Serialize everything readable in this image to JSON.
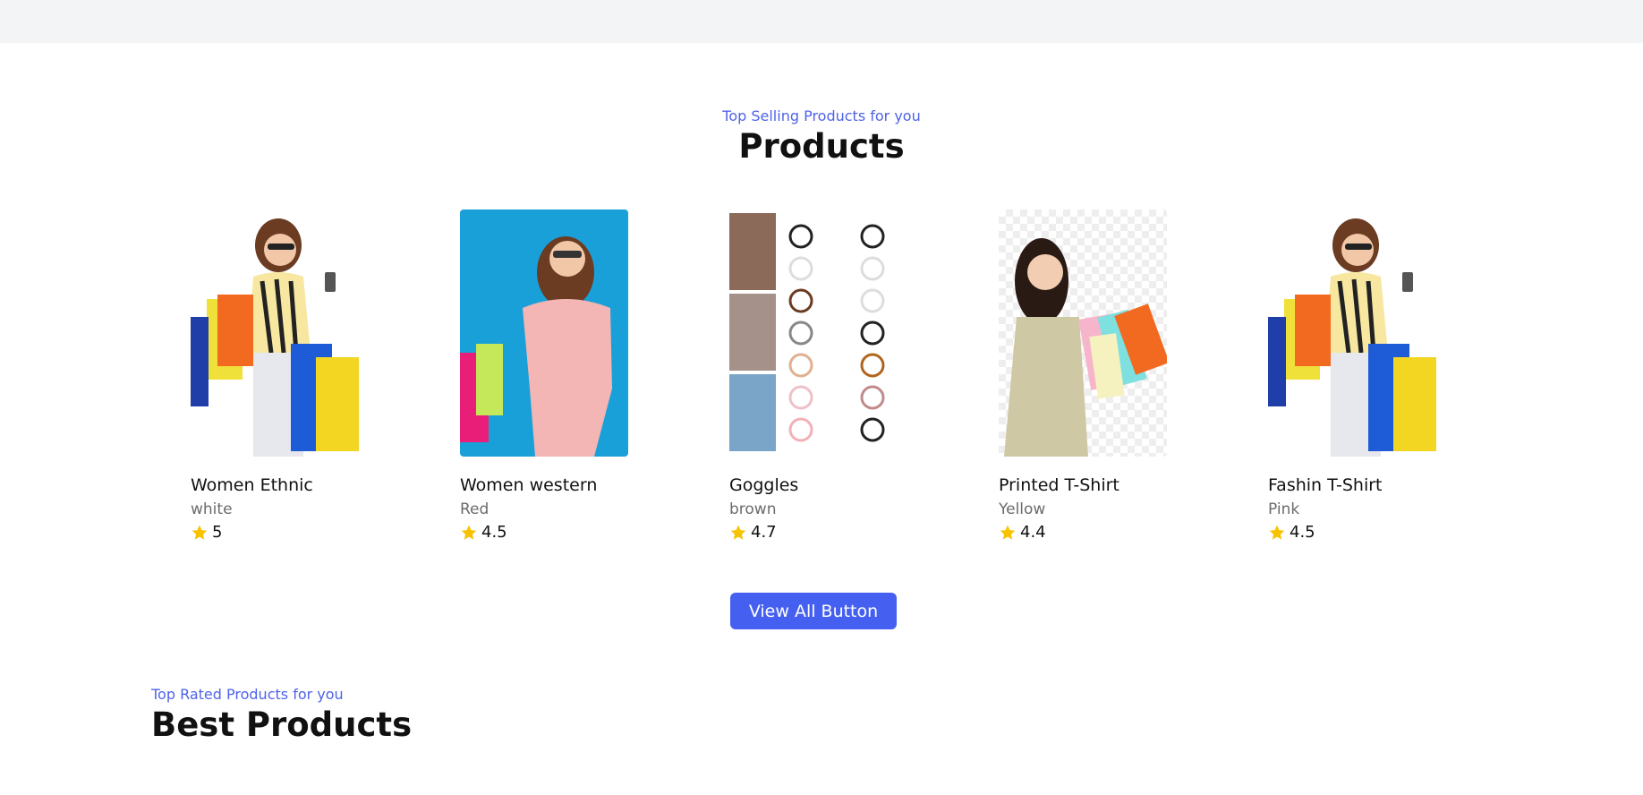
{
  "products_section": {
    "eyebrow": "Top Selling Products for you",
    "title": "Products",
    "button_label": "View All Button",
    "items": [
      {
        "name": "Women Ethnic",
        "color": "white",
        "rating": "5"
      },
      {
        "name": "Women western",
        "color": "Red",
        "rating": "4.5"
      },
      {
        "name": "Goggles",
        "color": "brown",
        "rating": "4.7"
      },
      {
        "name": "Printed T-Shirt",
        "color": "Yellow",
        "rating": "4.4"
      },
      {
        "name": "Fashin T-Shirt",
        "color": "Pink",
        "rating": "4.5"
      }
    ]
  },
  "best_section": {
    "eyebrow": "Top Rated Products for you",
    "title": "Best Products"
  },
  "colors": {
    "accent": "#4560f0",
    "star": "#f7c300",
    "topbar": "#f3f4f6"
  },
  "icons": {
    "rating": "star-icon"
  }
}
